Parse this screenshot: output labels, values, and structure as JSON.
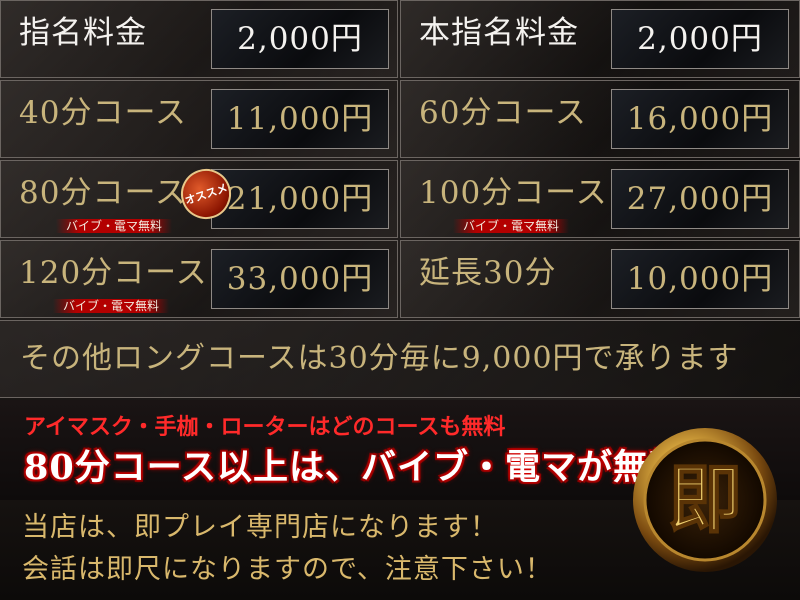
{
  "prices": {
    "nomination": {
      "label": "指名料金",
      "price": "2,000円"
    },
    "main_nomination": {
      "label": "本指名料金",
      "price": "2,000円"
    },
    "course40": {
      "label": "40分コース",
      "price": "11,000円"
    },
    "course60": {
      "label": "60分コース",
      "price": "16,000円"
    },
    "course80": {
      "label": "80分コース",
      "price": "21,000円",
      "note": "バイブ・電マ無料",
      "badge": "オススメ"
    },
    "course100": {
      "label": "100分コース",
      "price": "27,000円",
      "note": "バイブ・電マ無料"
    },
    "course120": {
      "label": "120分コース",
      "price": "33,000円",
      "note": "バイブ・電マ無料"
    },
    "extension30": {
      "label": "延長30分",
      "price": "10,000円"
    }
  },
  "long_course": "その他ロングコースは30分毎に9,000円で承ります",
  "free_options": {
    "line1": "アイマスク・手枷・ローターはどのコースも無料",
    "line2": "80分コース以上は、バイブ・電マが無料！"
  },
  "notice": {
    "line1": "当店は、即プレイ専門店になります！",
    "line2": "会話は即尺になりますので、注意下さい！"
  },
  "seal": {
    "glyph": "即"
  },
  "colors": {
    "gold": "#c8b47c",
    "white": "#f4f2ef",
    "red": "#ff2a2a",
    "banner_red": "#b30000"
  }
}
